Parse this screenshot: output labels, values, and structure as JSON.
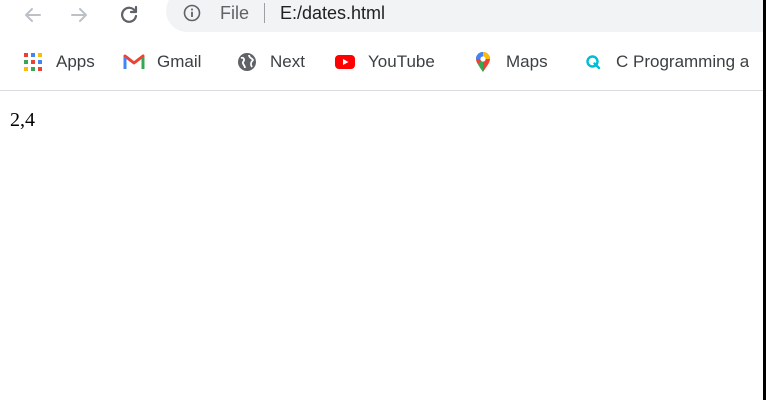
{
  "nav": {
    "back_icon": "back-arrow-icon",
    "forward_icon": "forward-arrow-icon",
    "reload_icon": "reload-icon"
  },
  "omnibox": {
    "security_icon": "info-icon",
    "scheme_label": "File",
    "url": "E:/dates.html"
  },
  "bookmarks": {
    "items": [
      {
        "label": "Apps",
        "icon": "apps-grid-icon"
      },
      {
        "label": "Gmail",
        "icon": "gmail-icon"
      },
      {
        "label": "Next",
        "icon": "globe-icon"
      },
      {
        "label": "YouTube",
        "icon": "youtube-icon"
      },
      {
        "label": "Maps",
        "icon": "maps-pin-icon"
      },
      {
        "label": "C Programming a",
        "icon": "q-icon"
      }
    ]
  },
  "page": {
    "output_text": "2,4"
  },
  "colors": {
    "omnibox_bg": "#f1f3f4",
    "text_primary": "#202124",
    "text_secondary": "#5f6368",
    "youtube_red": "#ff0000",
    "gmail_red": "#ea4335",
    "q_cyan": "#00bcd4"
  }
}
